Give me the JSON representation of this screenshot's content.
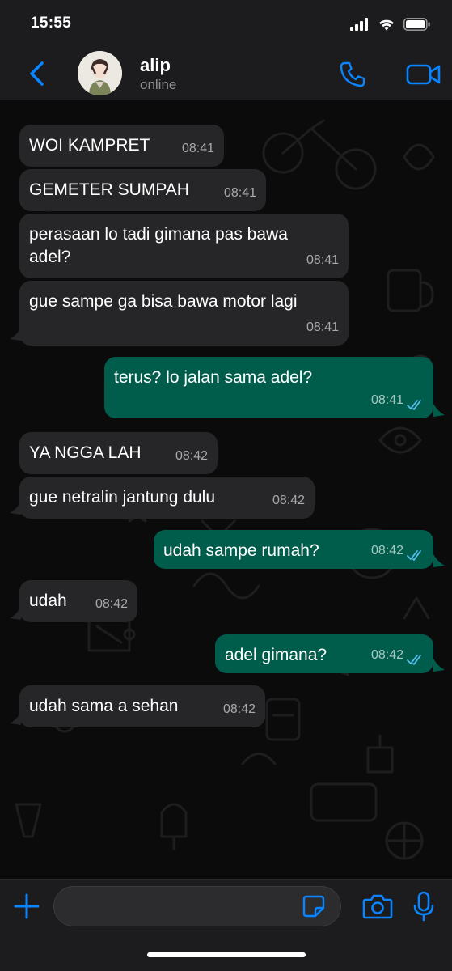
{
  "status_bar": {
    "time": "15:55",
    "icons": [
      "cellular-signal-icon",
      "wifi-icon",
      "battery-icon"
    ]
  },
  "header": {
    "contact_name": "alip",
    "contact_status": "online",
    "icons": [
      "back-chevron-icon",
      "phone-icon",
      "video-camera-icon"
    ]
  },
  "messages": [
    {
      "direction": "incoming",
      "text": "WOI KAMPRET",
      "time": "08:41"
    },
    {
      "direction": "incoming",
      "text": "GEMETER SUMPAH",
      "time": "08:41"
    },
    {
      "direction": "incoming",
      "text": "perasaan lo tadi gimana pas bawa adel?",
      "time": "08:41"
    },
    {
      "direction": "incoming",
      "text": "gue sampe ga bisa bawa motor lagi",
      "time": "08:41"
    },
    {
      "direction": "outgoing",
      "text": "terus? lo jalan sama adel?",
      "time": "08:41",
      "status": "read"
    },
    {
      "direction": "incoming",
      "text": "YA NGGA LAH",
      "time": "08:42"
    },
    {
      "direction": "incoming",
      "text": "gue netralin jantung dulu",
      "time": "08:42"
    },
    {
      "direction": "outgoing",
      "text": "udah sampe rumah?",
      "time": "08:42",
      "status": "read"
    },
    {
      "direction": "incoming",
      "text": "udah",
      "time": "08:42"
    },
    {
      "direction": "outgoing",
      "text": "adel gimana?",
      "time": "08:42",
      "status": "read"
    },
    {
      "direction": "incoming",
      "text": "udah sama a sehan",
      "time": "08:42"
    }
  ],
  "input_bar": {
    "placeholder": "",
    "icons": [
      "plus-icon",
      "sticker-icon",
      "camera-icon",
      "microphone-icon"
    ]
  },
  "colors": {
    "accent": "#0a84ff",
    "incoming_bubble": "#262628",
    "outgoing_bubble": "#005c4b",
    "read_ticks": "#53bdeb",
    "background": "#0b0b0b"
  }
}
